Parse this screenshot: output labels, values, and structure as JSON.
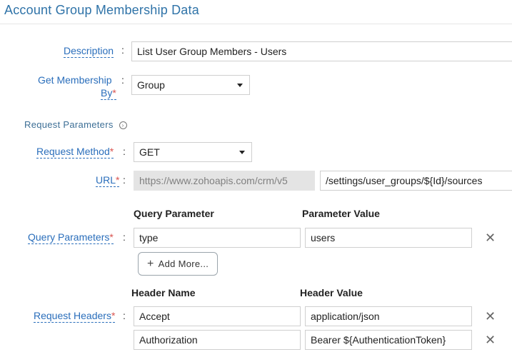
{
  "header": {
    "title": "Account Group Membership Data"
  },
  "fields": {
    "description": {
      "label": "Description",
      "value": "List User Group Members - Users"
    },
    "membership": {
      "label_line1": "Get Membership",
      "label_line2": "By",
      "value": "Group"
    },
    "section_label": "Request Parameters",
    "request_method": {
      "label": "Request Method",
      "value": "GET"
    },
    "url": {
      "label": "URL",
      "base": "https://www.zohoapis.com/crm/v5",
      "path": "/settings/user_groups/${Id}/sources"
    }
  },
  "query": {
    "label": "Query Parameters",
    "col_param": "Query Parameter",
    "col_value": "Parameter Value",
    "rows": [
      {
        "param": "type",
        "value": "users"
      }
    ],
    "add_more": "Add More..."
  },
  "headers": {
    "label": "Request Headers",
    "col_name": "Header Name",
    "col_value": "Header Value",
    "rows": [
      {
        "name": "Accept",
        "value": "application/json"
      },
      {
        "name": "Authorization",
        "value": "Bearer ${AuthenticationToken}"
      }
    ]
  },
  "symbols": {
    "required": "*",
    "colon": ":",
    "close": "✕",
    "plus": "+",
    "info": "›"
  },
  "icons": [
    "info-icon",
    "caret-down-icon",
    "close-icon",
    "plus-icon"
  ],
  "colors": {
    "title": "#2f73a8",
    "label": "#2a6ebb",
    "required": "#d9534f",
    "disabled_bg": "#e4e4e4"
  }
}
